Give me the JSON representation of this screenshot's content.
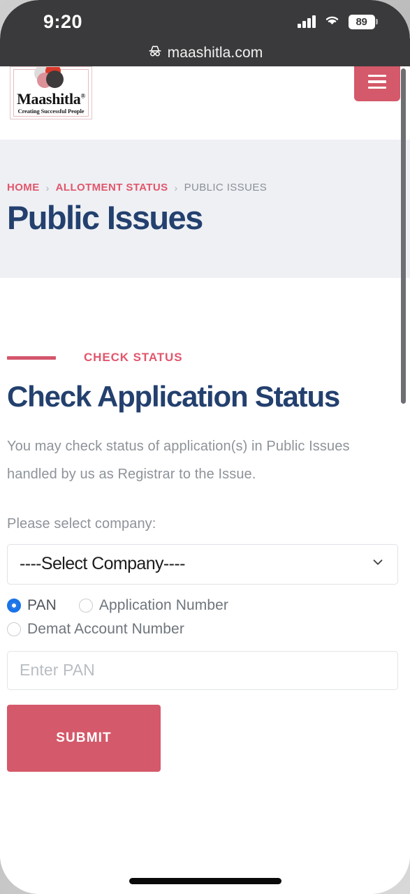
{
  "statusbar": {
    "time": "9:20",
    "battery_percent": "89",
    "signal_icon": "cellular-signal-icon",
    "wifi_icon": "wifi-icon",
    "battery_icon": "battery-icon"
  },
  "browser": {
    "url": "maashitla.com",
    "privacy_icon": "incognito-icon"
  },
  "site_header": {
    "logo_name": "Maashitla",
    "logo_trademark": "®",
    "logo_tagline": "Creating Successful People",
    "menu_icon": "hamburger-menu-icon",
    "logo_colors": {
      "circle_grey": "#dcdcdc",
      "circle_red": "#d93a2b",
      "circle_pink": "#dc9198",
      "circle_dark": "#3d3a3b"
    }
  },
  "banner": {
    "breadcrumb": [
      {
        "label": "HOME",
        "current": false
      },
      {
        "label": "ALLOTMENT STATUS",
        "current": false
      },
      {
        "label": "PUBLIC ISSUES",
        "current": true
      }
    ],
    "separator": "›",
    "title": "Public Issues",
    "background_color": "#eef0f4",
    "title_color": "#23406e",
    "link_color": "#e1566c"
  },
  "main": {
    "eyebrow": "CHECK STATUS",
    "heading": "Check Application Status",
    "description": "You may check status of application(s) in Public Issues handled by us as Registrar to the Issue.",
    "select_label": "Please select company:",
    "company_select": {
      "selected": "----Select Company----",
      "chevron_icon": "chevron-down-icon"
    },
    "radio_options": [
      {
        "label": "PAN",
        "selected": true
      },
      {
        "label": "Application Number",
        "selected": false
      },
      {
        "label": "Demat Account Number",
        "selected": false
      }
    ],
    "pan_input": {
      "placeholder": "Enter PAN",
      "value": ""
    },
    "submit_label": "SUBMIT",
    "accent_color": "#d4596a",
    "radio_selected_color": "#1a73e8"
  }
}
